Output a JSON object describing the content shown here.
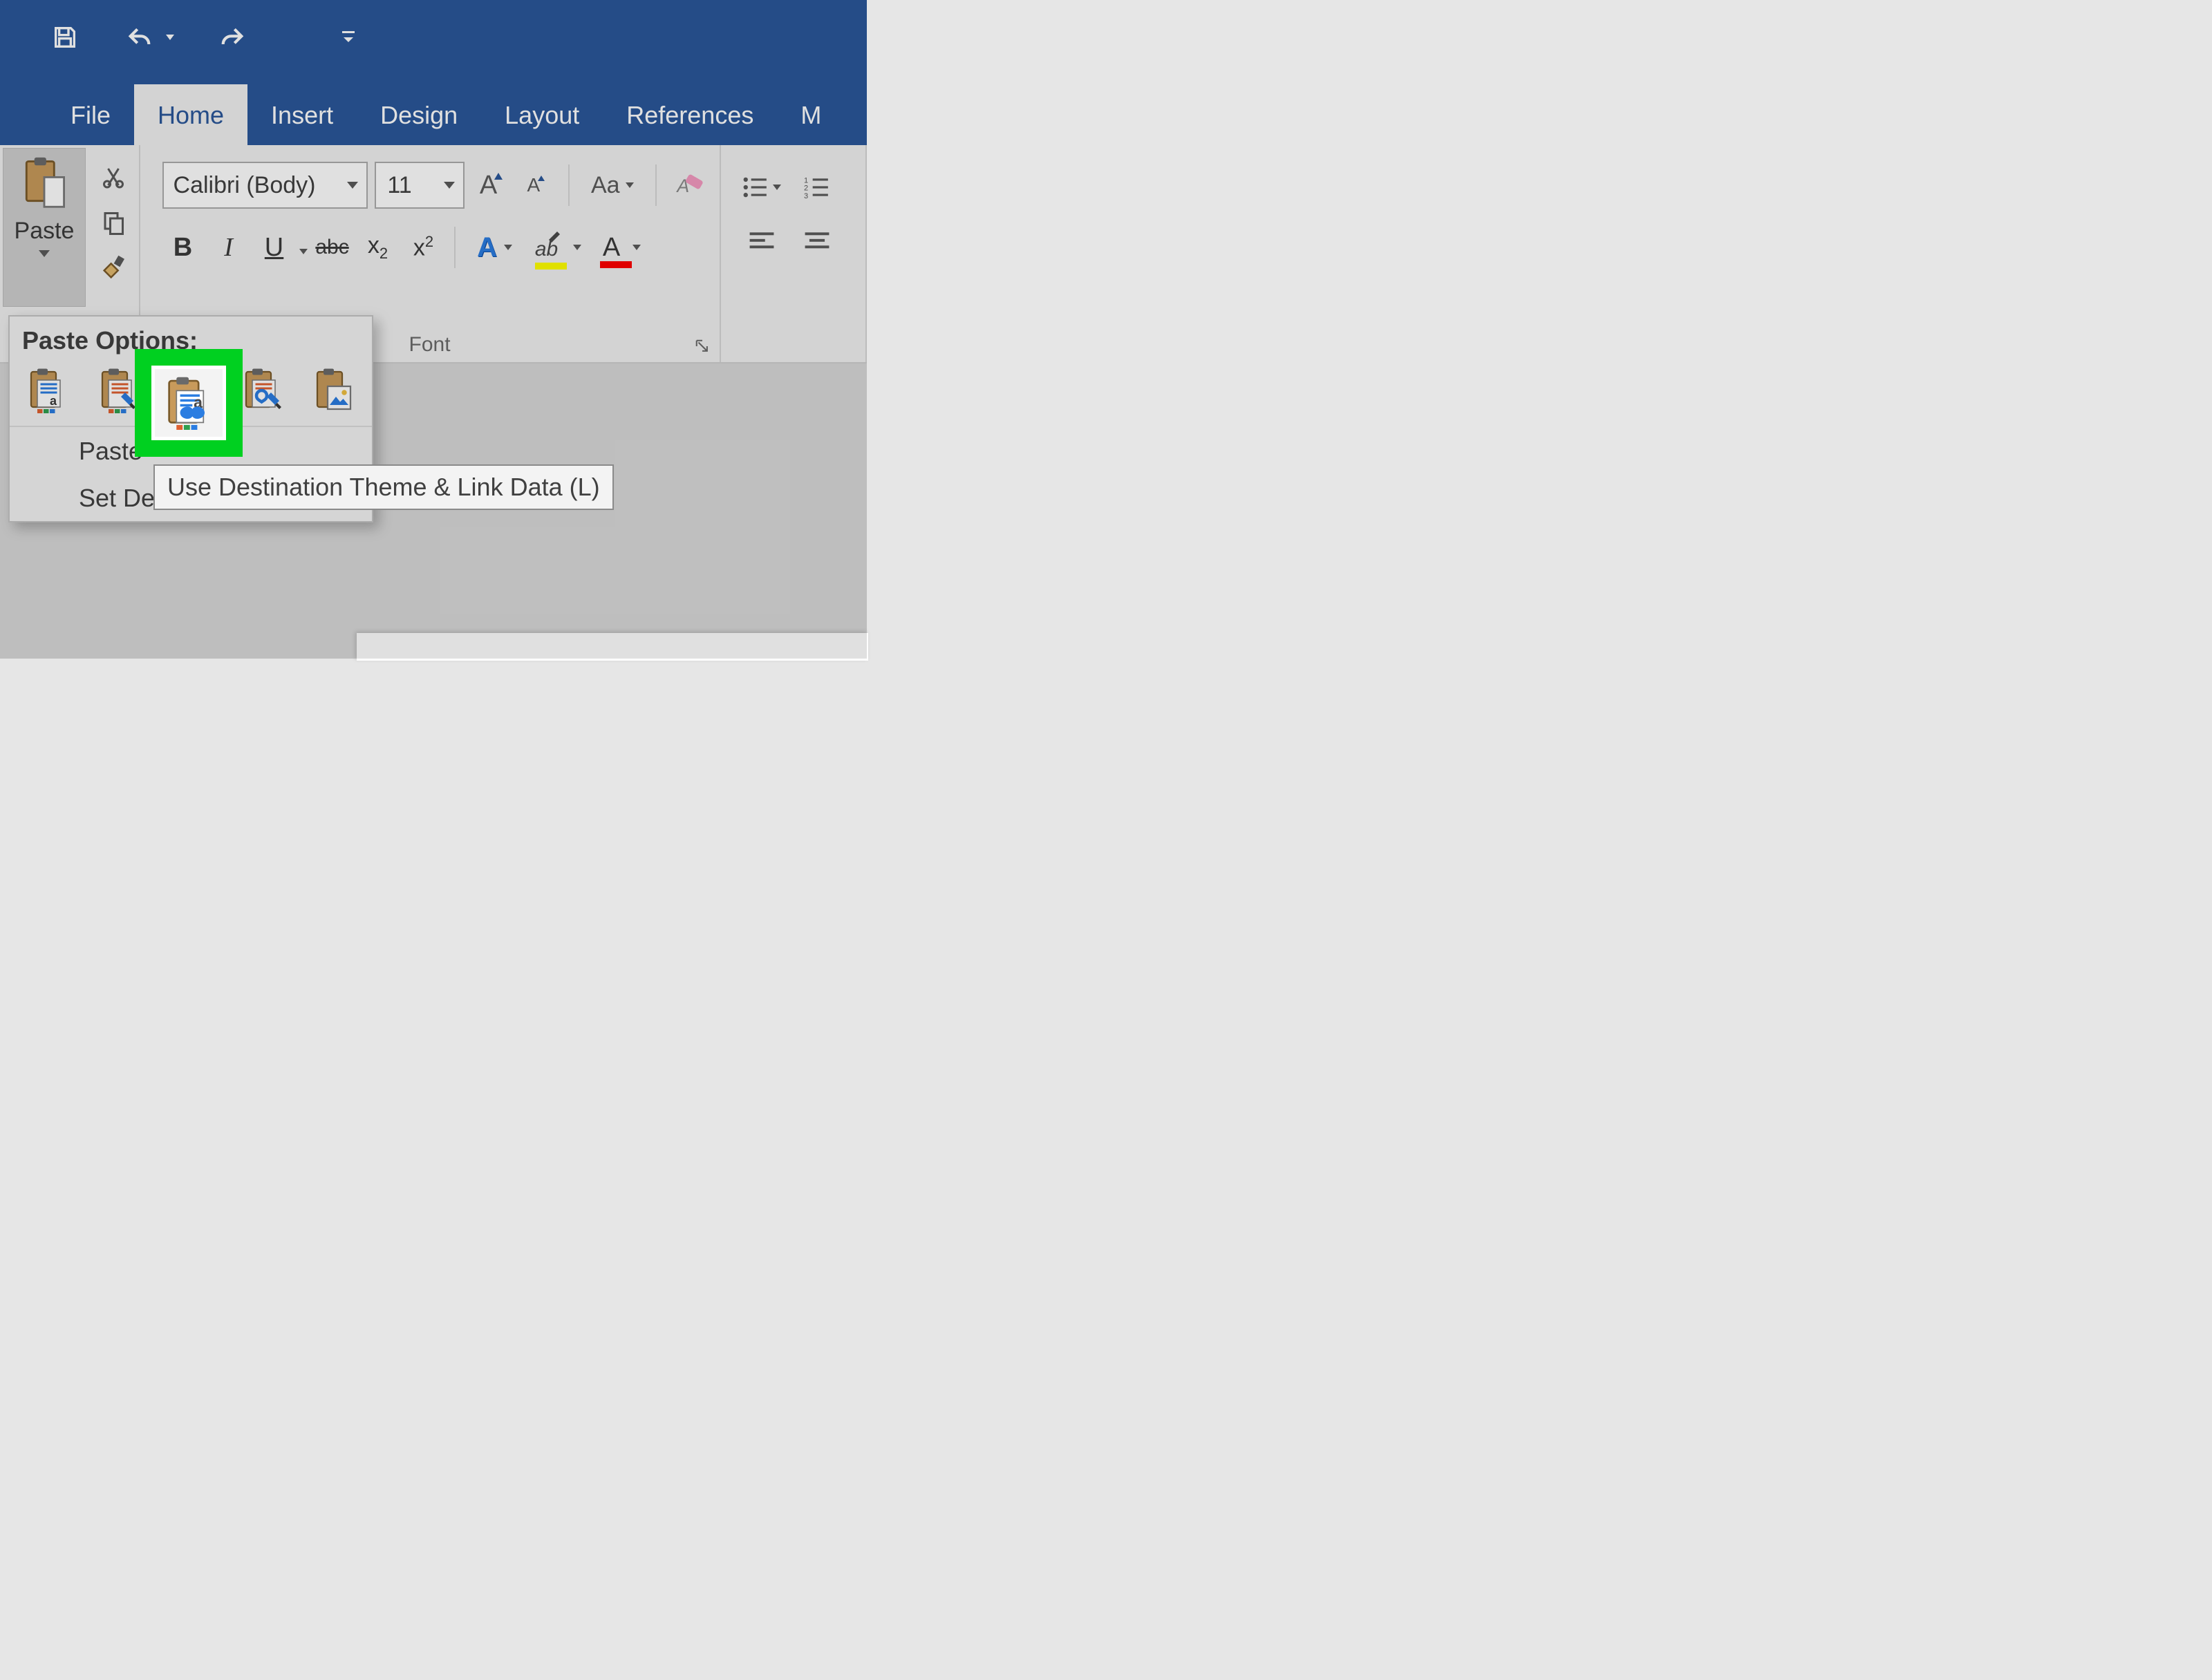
{
  "tabs": {
    "file": "File",
    "home": "Home",
    "insert": "Insert",
    "design": "Design",
    "layout": "Layout",
    "references": "References",
    "next": "M"
  },
  "clipboard": {
    "paste_label": "Paste"
  },
  "font": {
    "name": "Calibri (Body)",
    "size": "11",
    "bold": "B",
    "italic": "I",
    "underline": "U",
    "strike": "abc",
    "sub": "x",
    "sub2": "2",
    "sup": "x",
    "sup2": "2",
    "change_case": "Aa",
    "text_effects": "A",
    "highlight": "ab",
    "font_color": "A",
    "grow": "A",
    "shrink": "A",
    "group_label": "Font"
  },
  "paste_menu": {
    "header": "Paste Options:",
    "paste_special": "Paste",
    "set_default": "Set Default Paste..."
  },
  "tooltip": {
    "text": "Use Destination Theme & Link Data (L)"
  }
}
